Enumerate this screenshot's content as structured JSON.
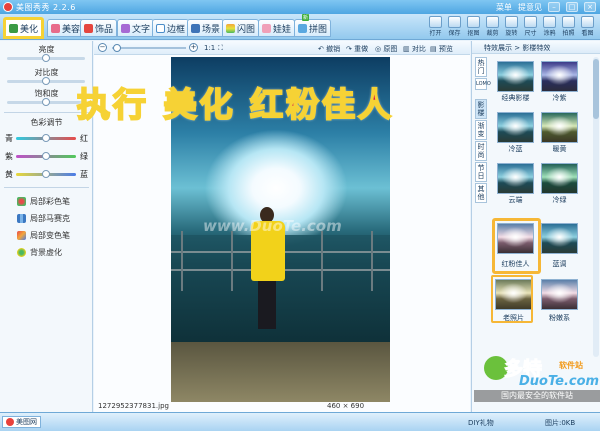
{
  "window": {
    "title": "美图秀秀 2.2.6",
    "menu_label": "菜单",
    "feedback_label": "提意见"
  },
  "tabs": [
    {
      "label": "美化",
      "active": true
    },
    {
      "label": "美容"
    },
    {
      "label": "饰品"
    },
    {
      "label": "文字"
    },
    {
      "label": "边框"
    },
    {
      "label": "场景"
    },
    {
      "label": "闪图"
    },
    {
      "label": "娃娃"
    },
    {
      "label": "拼图",
      "badge": "新"
    }
  ],
  "toolbar_tools": [
    "打开",
    "保存",
    "抠图",
    "裁剪",
    "旋转",
    "尺寸",
    "涂鸦",
    "拍照",
    "看图"
  ],
  "left_panel": {
    "brightness_label": "亮度",
    "contrast_label": "对比度",
    "saturation_label": "饱和度",
    "color_adjust_label": "色彩调节",
    "color_rows": [
      {
        "left": "青",
        "right": "红"
      },
      {
        "left": "紫",
        "right": "绿"
      },
      {
        "left": "黄",
        "right": "蓝"
      }
    ],
    "links": [
      "局部彩色笔",
      "局部马赛克",
      "局部变色笔",
      "背景虚化"
    ]
  },
  "canvas_toolbar": {
    "ratio": "1:1",
    "undo": "撤销",
    "redo": "重做",
    "original": "原图",
    "compare": "对比",
    "preview": "预览"
  },
  "canvas": {
    "watermark": "www.DuoTe.com",
    "filename": "1272952377831.jpg",
    "image_size": "460 × 690"
  },
  "right_panel": {
    "header": "特效展示 > 影楼特效",
    "vertical_tabs": [
      "热门",
      "LOMO",
      "影楼",
      "渐变",
      "时尚",
      "节日",
      "其他"
    ],
    "effects": [
      {
        "label": "经典影楼"
      },
      {
        "label": "冷紫"
      },
      {
        "label": "冷蓝"
      },
      {
        "label": "暖黄"
      },
      {
        "label": "云端"
      },
      {
        "label": "冷绿"
      },
      {
        "label": "红粉佳人"
      },
      {
        "label": "蓝调"
      },
      {
        "label": "老照片"
      },
      {
        "label": "粉嫩系"
      }
    ]
  },
  "overlay": {
    "heading": "执行 美化 红粉佳人"
  },
  "taskbar": {
    "app_button": "美图网",
    "right_items": [
      "DIY礼物",
      "图片:0KB"
    ]
  },
  "corner_logo": {
    "cn": "多特",
    "site": "软件站",
    "en": "DuoTe.com",
    "slogan": "国内最安全的软件站"
  },
  "colors": {
    "accent_highlight": "#f6d235",
    "overlay_text": "#d8114e"
  }
}
